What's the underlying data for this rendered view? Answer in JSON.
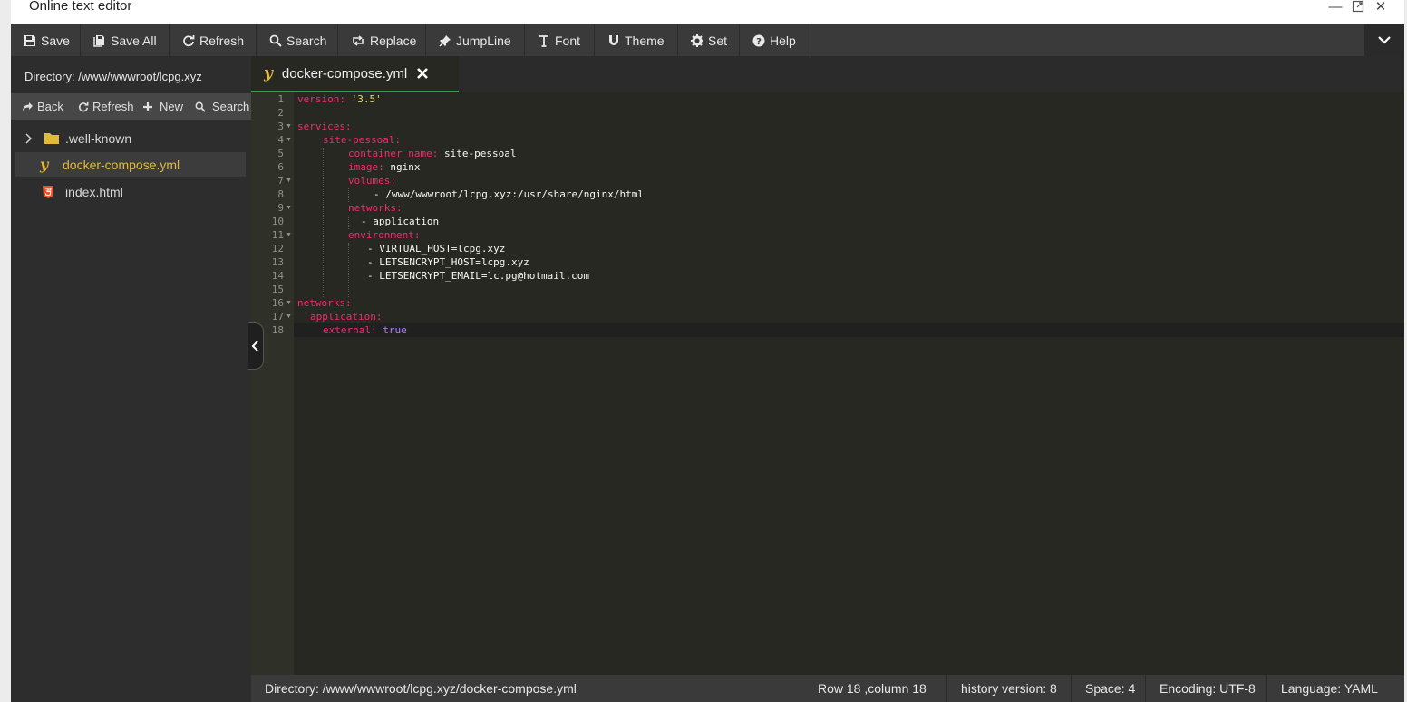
{
  "window": {
    "title": "Online text editor"
  },
  "toolbar": {
    "save": "Save",
    "save_all": "Save All",
    "refresh": "Refresh",
    "search": "Search",
    "replace": "Replace",
    "jumpline": "JumpLine",
    "font": "Font",
    "theme": "Theme",
    "set": "Set",
    "help": "Help"
  },
  "sidebar": {
    "directory": "Directory: /www/wwwroot/lcpg.xyz",
    "tools": {
      "back": "Back",
      "refresh": "Refresh",
      "new": "New",
      "search": "Search"
    },
    "files": [
      {
        "name": ".well-known",
        "icon": "folder-icon"
      },
      {
        "name": "docker-compose.yml",
        "icon": "yaml-icon"
      },
      {
        "name": "index.html",
        "icon": "html5-icon"
      }
    ]
  },
  "tab": {
    "name": "docker-compose.yml"
  },
  "editor": {
    "line_numbers": [
      "1",
      "2",
      "3",
      "4",
      "5",
      "6",
      "7",
      "8",
      "9",
      "10",
      "11",
      "12",
      "13",
      "14",
      "15",
      "16",
      "17",
      "18"
    ],
    "lines": [
      {
        "key": "version:",
        "val": " '3.5'"
      },
      {
        "text": ""
      },
      {
        "key": "services:"
      },
      {
        "key": "site-pessoal:"
      },
      {
        "key": "container_name:",
        "val": " site-pessoal"
      },
      {
        "key": "image:",
        "val": " nginx"
      },
      {
        "key": "volumes:"
      },
      {
        "text": "- /www/wwwroot/lcpg.xyz:/usr/share/nginx/html"
      },
      {
        "key": "networks:"
      },
      {
        "text": "- application"
      },
      {
        "key": "environment:"
      },
      {
        "text": "- VIRTUAL_HOST=lcpg.xyz"
      },
      {
        "text": "- LETSENCRYPT_HOST=lcpg.xyz"
      },
      {
        "text": "- LETSENCRYPT_EMAIL=lc.pg@hotmail.com"
      },
      {
        "text": ""
      },
      {
        "key": "networks:"
      },
      {
        "key": "application:"
      },
      {
        "key": "external:",
        "val": " true"
      }
    ]
  },
  "status": {
    "path": "Directory: /www/wwwroot/lcpg.xyz/docker-compose.yml",
    "position": "Row 18 ,column 18",
    "history": "history version: 8",
    "space": "Space: 4",
    "encoding": "Encoding: UTF-8",
    "language": "Language: YAML"
  },
  "colors": {
    "keyword": "#f92672",
    "string": "#e6db74",
    "boolean": "#ae81ff",
    "active_tab_underline": "#2ea44f",
    "active_file": "#e2b93b"
  }
}
